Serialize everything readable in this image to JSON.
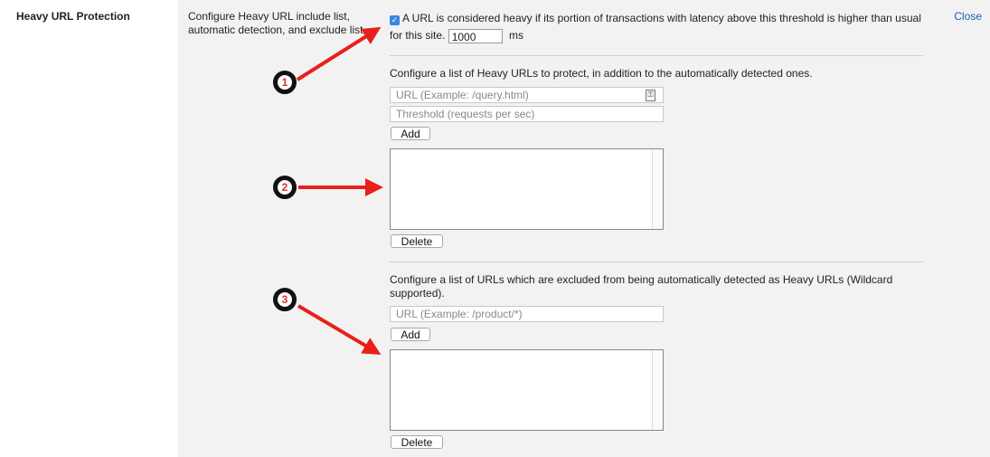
{
  "section": {
    "title": "Heavy URL Protection",
    "description": "Configure Heavy URL include list, automatic detection, and exclude list",
    "close_label": "Close"
  },
  "threshold": {
    "checked": true,
    "text_part1": "A URL is considered heavy if its portion of transactions with latency above this threshold is higher than usual",
    "text_part2": "for this site.",
    "value": "1000",
    "unit": "ms"
  },
  "include_list": {
    "label": "Configure a list of Heavy URLs to protect, in addition to the automatically detected ones.",
    "url_placeholder": "URL (Example: /query.html)",
    "threshold_placeholder": "Threshold (requests per sec)",
    "add_label": "Add",
    "delete_label": "Delete"
  },
  "exclude_list": {
    "label": "Configure a list of URLs which are excluded from being automatically detected as Heavy URLs (Wildcard supported).",
    "url_placeholder": "URL (Example: /product/*)",
    "add_label": "Add",
    "delete_label": "Delete"
  },
  "callouts": [
    "1",
    "2",
    "3"
  ],
  "colors": {
    "panel_bg": "#f2f2f2",
    "link": "#1a5fb4",
    "arrow": "#e8201c",
    "checkbox": "#3b86e0"
  }
}
